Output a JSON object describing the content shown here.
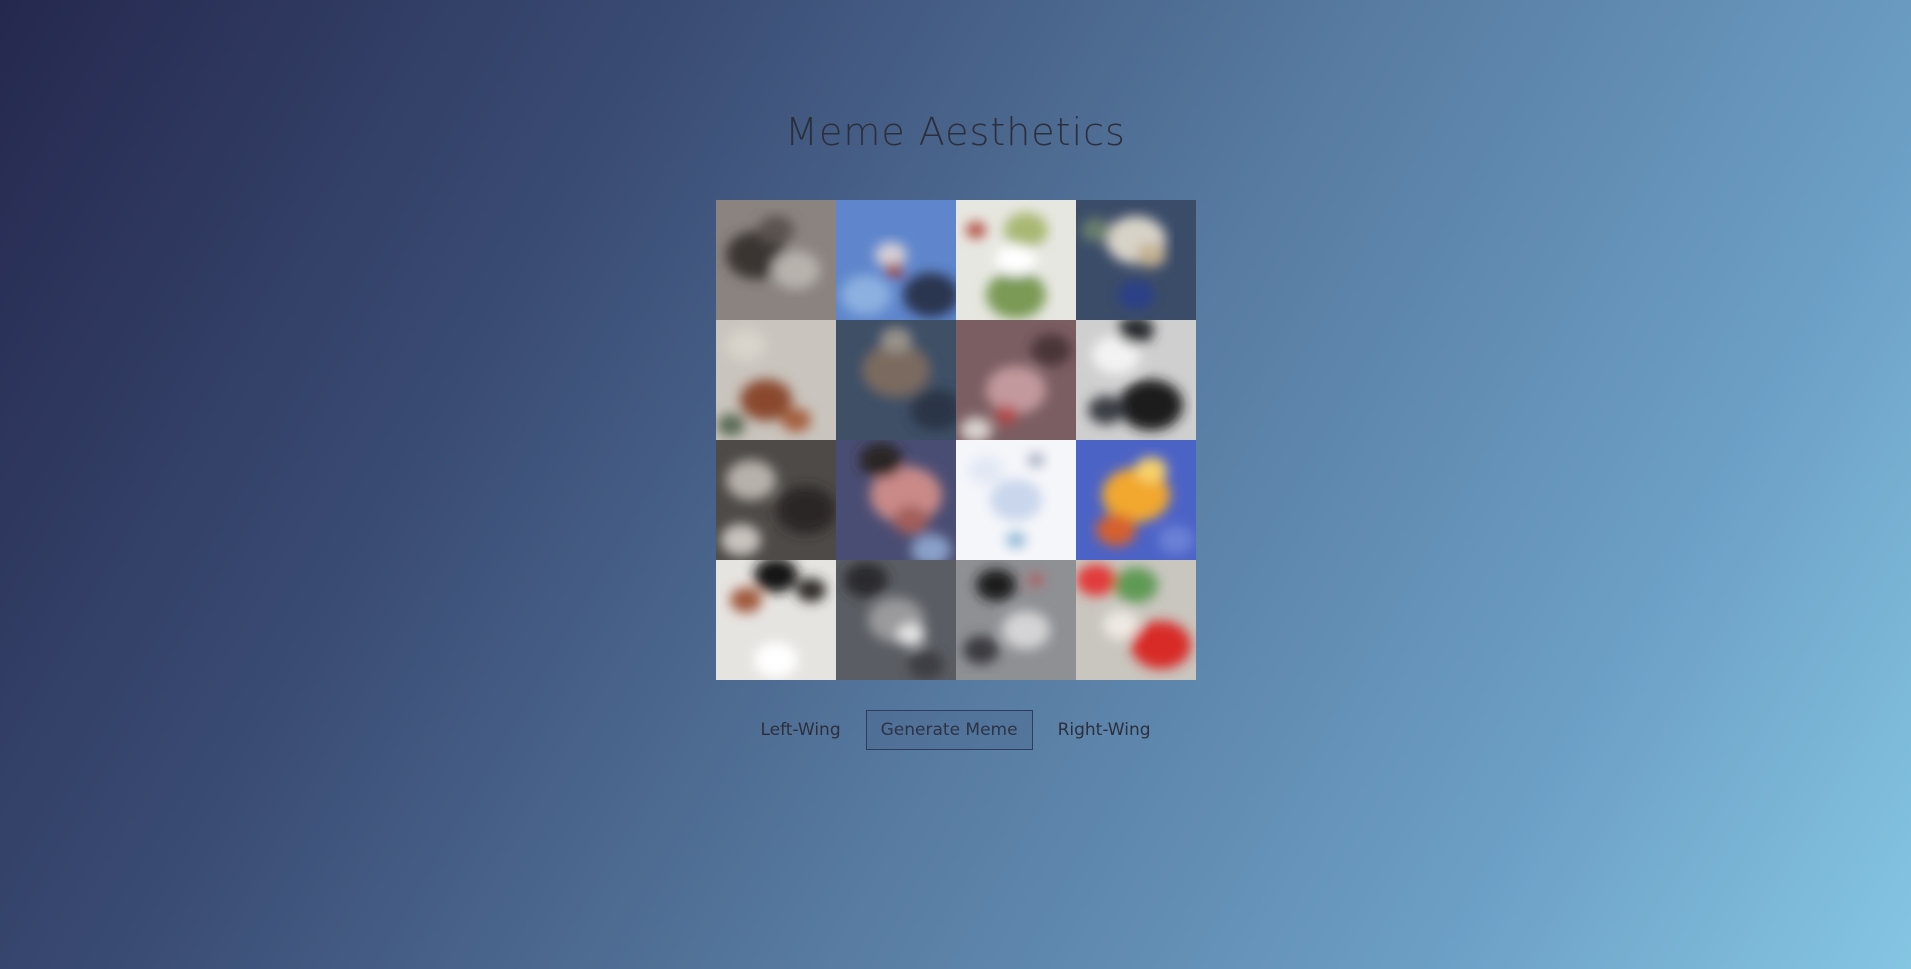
{
  "page": {
    "title": "Meme Aesthetics"
  },
  "tiles": [
    {
      "name": "meme-tile-1",
      "bg": "#8a8380",
      "blobs": [
        [
          "#3a3432",
          40,
          55,
          30
        ],
        [
          "#b8b2ad",
          80,
          70,
          24
        ],
        [
          "#5a5350",
          60,
          30,
          18
        ]
      ]
    },
    {
      "name": "meme-tile-2",
      "bg": "#5f86cc",
      "blobs": [
        [
          "#2a3550",
          95,
          95,
          28
        ],
        [
          "#d7d0d6",
          55,
          55,
          16
        ],
        [
          "#a33c2c",
          58,
          70,
          9
        ],
        [
          "#8cb0e0",
          30,
          95,
          25
        ]
      ]
    },
    {
      "name": "meme-tile-3",
      "bg": "#e7e7e1",
      "blobs": [
        [
          "#7a9a55",
          60,
          95,
          30
        ],
        [
          "#a9b873",
          70,
          30,
          22
        ],
        [
          "#b04a3a",
          20,
          30,
          10
        ],
        [
          "#ffffff",
          60,
          60,
          20
        ]
      ]
    },
    {
      "name": "meme-tile-4",
      "bg": "#3b4c68",
      "blobs": [
        [
          "#d8d3c8",
          60,
          40,
          30
        ],
        [
          "#6a7f6e",
          20,
          30,
          15
        ],
        [
          "#2a3f88",
          60,
          95,
          18
        ],
        [
          "#c4b293",
          75,
          55,
          15
        ]
      ]
    },
    {
      "name": "meme-tile-5",
      "bg": "#c9c4bd",
      "blobs": [
        [
          "#8a4a2e",
          50,
          80,
          26
        ],
        [
          "#d8d3cb",
          30,
          25,
          20
        ],
        [
          "#5a6b55",
          15,
          105,
          14
        ],
        [
          "#a46040",
          80,
          100,
          15
        ]
      ]
    },
    {
      "name": "meme-tile-6",
      "bg": "#3e4f66",
      "blobs": [
        [
          "#7a6a5e",
          60,
          50,
          34
        ],
        [
          "#2a3547",
          100,
          90,
          26
        ],
        [
          "#97928a",
          60,
          20,
          16
        ]
      ]
    },
    {
      "name": "meme-tile-7",
      "bg": "#7b5e62",
      "blobs": [
        [
          "#c29a9e",
          60,
          70,
          30
        ],
        [
          "#d8d0cc",
          20,
          110,
          16
        ],
        [
          "#4a3537",
          95,
          30,
          20
        ],
        [
          "#b2484a",
          50,
          95,
          12
        ]
      ]
    },
    {
      "name": "meme-tile-8",
      "bg": "#cfcfcf",
      "blobs": [
        [
          "#1a1a1c",
          75,
          85,
          32
        ],
        [
          "#3a3d44",
          30,
          90,
          18
        ],
        [
          "#f3f3f3",
          40,
          35,
          24
        ],
        [
          "#2b2d33",
          60,
          10,
          18
        ]
      ]
    },
    {
      "name": "meme-tile-9",
      "bg": "#4d4a47",
      "blobs": [
        [
          "#b7b1ab",
          35,
          40,
          25
        ],
        [
          "#c8c3bd",
          25,
          100,
          20
        ],
        [
          "#2a2826",
          90,
          70,
          30
        ]
      ]
    },
    {
      "name": "meme-tile-10",
      "bg": "#4a4d73",
      "blobs": [
        [
          "#c98a88",
          70,
          55,
          36
        ],
        [
          "#2a2626",
          45,
          20,
          22
        ],
        [
          "#8aa0c8",
          95,
          110,
          20
        ],
        [
          "#a35e5a",
          75,
          80,
          18
        ]
      ]
    },
    {
      "name": "meme-tile-11",
      "bg": "#f5f6fa",
      "blobs": [
        [
          "#c9d6ec",
          60,
          60,
          26
        ],
        [
          "#8fb8d4",
          60,
          100,
          10
        ],
        [
          "#e2e8f4",
          30,
          30,
          18
        ],
        [
          "#9aa3b8",
          80,
          20,
          8
        ]
      ]
    },
    {
      "name": "meme-tile-12",
      "bg": "#4c63c6",
      "blobs": [
        [
          "#f2a72f",
          60,
          55,
          34
        ],
        [
          "#d5602e",
          40,
          90,
          20
        ],
        [
          "#f7d16a",
          75,
          30,
          16
        ],
        [
          "#6a80d6",
          100,
          100,
          18
        ]
      ]
    },
    {
      "name": "meme-tile-13",
      "bg": "#e6e4e1",
      "blobs": [
        [
          "#151414",
          60,
          15,
          22
        ],
        [
          "#a05a3e",
          30,
          40,
          16
        ],
        [
          "#2e2a28",
          95,
          30,
          15
        ],
        [
          "#ffffff",
          60,
          100,
          22
        ]
      ]
    },
    {
      "name": "meme-tile-14",
      "bg": "#5a5d63",
      "blobs": [
        [
          "#9a9a9c",
          60,
          60,
          28
        ],
        [
          "#e4e4e4",
          75,
          75,
          14
        ],
        [
          "#2a2b2e",
          30,
          20,
          22
        ],
        [
          "#3c3e42",
          90,
          105,
          18
        ]
      ]
    },
    {
      "name": "meme-tile-15",
      "bg": "#8f9094",
      "blobs": [
        [
          "#1c1c1e",
          40,
          25,
          20
        ],
        [
          "#d4d4d6",
          70,
          70,
          24
        ],
        [
          "#3a3b3f",
          25,
          90,
          18
        ],
        [
          "#c23c3c",
          80,
          20,
          6
        ]
      ]
    },
    {
      "name": "meme-tile-16",
      "bg": "#c9c6bf",
      "blobs": [
        [
          "#d82b27",
          85,
          85,
          30
        ],
        [
          "#e23b3b",
          20,
          20,
          20
        ],
        [
          "#5e9a54",
          60,
          25,
          22
        ],
        [
          "#eeeae3",
          45,
          65,
          18
        ]
      ]
    }
  ],
  "controls": {
    "left_label": "Left-Wing",
    "generate_label": "Generate Meme",
    "right_label": "Right-Wing"
  }
}
